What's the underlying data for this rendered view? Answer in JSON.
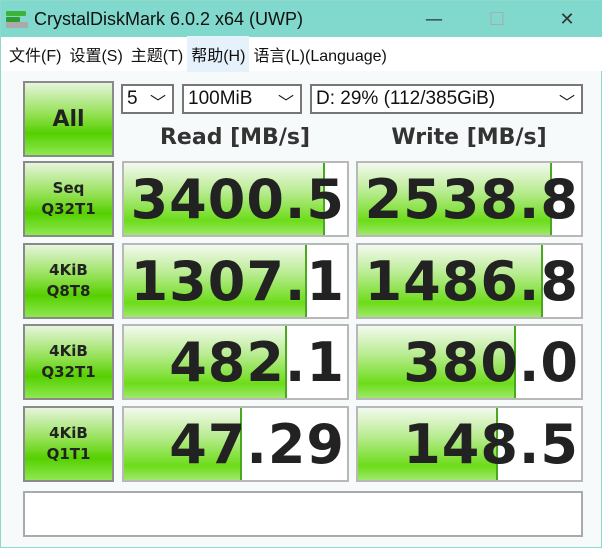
{
  "window": {
    "title": "CrystalDiskMark 6.0.2 x64 (UWP)",
    "minimize": "—",
    "maximize": "☐",
    "close": "✕"
  },
  "menu": [
    {
      "label": "文件(F)"
    },
    {
      "label": "设置(S)"
    },
    {
      "label": "主题(T)"
    },
    {
      "label": "帮助(H)"
    },
    {
      "label": "语言(L)(Language)"
    }
  ],
  "controls": {
    "all_label": "All",
    "count": "5",
    "size": "100MiB",
    "drive": "D: 29% (112/385GiB)",
    "chevron": "﹀"
  },
  "headers": {
    "read": "Read [MB/s]",
    "write": "Write [MB/s]"
  },
  "tests": [
    {
      "line1": "Seq",
      "line2": "Q32T1",
      "read": "3400.5",
      "write": "2538.8",
      "read_fill": 0.9,
      "write_fill": 0.87
    },
    {
      "line1": "4KiB",
      "line2": "Q8T8",
      "read": "1307.1",
      "write": "1486.8",
      "read_fill": 0.82,
      "write_fill": 0.83
    },
    {
      "line1": "4KiB",
      "line2": "Q32T1",
      "read": "482.1",
      "write": "380.0",
      "read_fill": 0.73,
      "write_fill": 0.71
    },
    {
      "line1": "4KiB",
      "line2": "Q1T1",
      "read": "47.29",
      "write": "148.5",
      "read_fill": 0.53,
      "write_fill": 0.63
    }
  ],
  "status": ""
}
